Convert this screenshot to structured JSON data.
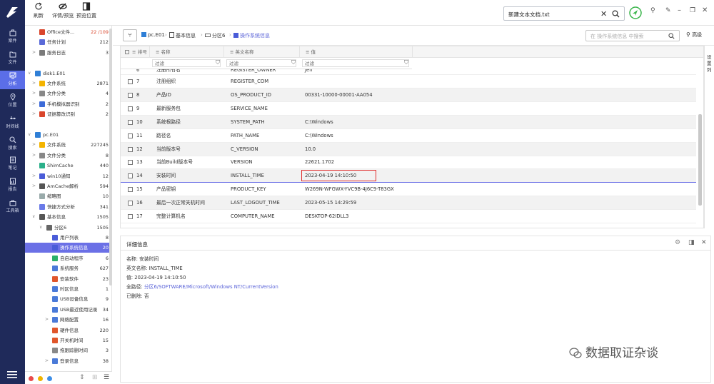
{
  "rail": {
    "items": [
      {
        "label": "案件",
        "icon": "briefcase-icon"
      },
      {
        "label": "文件",
        "icon": "folder-icon"
      },
      {
        "label": "分析",
        "icon": "analysis-icon",
        "active": true
      },
      {
        "label": "位置",
        "icon": "location-icon"
      },
      {
        "label": "时间线",
        "icon": "timeline-icon"
      },
      {
        "label": "搜索",
        "icon": "search-icon"
      },
      {
        "label": "笔记",
        "icon": "note-icon"
      },
      {
        "label": "报告",
        "icon": "report-icon"
      },
      {
        "label": "工具箱",
        "icon": "toolbox-icon"
      }
    ]
  },
  "toolbar": {
    "refresh_label": "刷新",
    "detail_label": "详情/预览",
    "preview_pos_label": "预览位置",
    "search_value": "新建文本文档.txt"
  },
  "tree": {
    "rows": [
      {
        "label": "Office文件...",
        "count": "22 /109",
        "indent": 1,
        "icon_color": "#d9452b",
        "redcount": true
      },
      {
        "label": "任务计划",
        "count": "212",
        "indent": 1,
        "icon_color": "#5a6ad8"
      },
      {
        "label": "服务日志",
        "count": "3",
        "indent": 1,
        "icon_color": "#7a7a7a",
        "arrow": ">"
      },
      {
        "label": "",
        "count": "",
        "indent": 0
      },
      {
        "label": "disk1.E01",
        "count": "",
        "indent": 0,
        "icon_color": "#2f7fd6",
        "arrow": "∨"
      },
      {
        "label": "文件系统",
        "count": "2871",
        "indent": 1,
        "icon_color": "#f4b400",
        "arrow": ">"
      },
      {
        "label": "文件分类",
        "count": "4",
        "indent": 1,
        "icon_color": "#888",
        "arrow": ">"
      },
      {
        "label": "手机模拟器识别",
        "count": "2",
        "indent": 1,
        "icon_color": "#3d6bd8",
        "arrow": ">"
      },
      {
        "label": "证据篡改识别",
        "count": "2",
        "indent": 1,
        "icon_color": "#d9452b",
        "arrow": ">"
      },
      {
        "label": "",
        "count": "",
        "indent": 0
      },
      {
        "label": "pc.E01",
        "count": "",
        "indent": 0,
        "icon_color": "#2f7fd6",
        "arrow": "∨"
      },
      {
        "label": "文件系统",
        "count": "227245",
        "indent": 1,
        "icon_color": "#f4b400",
        "arrow": ">"
      },
      {
        "label": "文件分类",
        "count": "8",
        "indent": 1,
        "icon_color": "#888",
        "arrow": ">"
      },
      {
        "label": "ShimCache",
        "count": "440",
        "indent": 1,
        "icon_color": "#2bb08a"
      },
      {
        "label": "win10通知",
        "count": "12",
        "indent": 1,
        "icon_color": "#4a5cd8",
        "arrow": ">"
      },
      {
        "label": "AmCache解析",
        "count": "594",
        "indent": 1,
        "icon_color": "#555",
        "arrow": ">"
      },
      {
        "label": "缩略图",
        "count": "10",
        "indent": 1,
        "icon_color": "#9aa",
        "arrow": ""
      },
      {
        "label": "快捷方式分析",
        "count": "341",
        "indent": 1,
        "icon_color": "#6a7ae8"
      },
      {
        "label": "基本信息",
        "count": "1505",
        "indent": 1,
        "icon_color": "#555",
        "arrow": "∨"
      },
      {
        "label": "分区6",
        "count": "1505",
        "indent": 2,
        "icon_color": "#666",
        "arrow": "∨"
      },
      {
        "label": "用户列表",
        "count": "8",
        "indent": 3,
        "icon_color": "#4a5cd8"
      },
      {
        "label": "操作系统信息",
        "count": "20",
        "indent": 3,
        "icon_color": "#4a5cd8",
        "selected": true
      },
      {
        "label": "自启动程序",
        "count": "6",
        "indent": 3,
        "icon_color": "#2bb06a"
      },
      {
        "label": "系统服务",
        "count": "627",
        "indent": 3,
        "icon_color": "#4a7ad8"
      },
      {
        "label": "安装软件",
        "count": "23",
        "indent": 3,
        "icon_color": "#e0562b"
      },
      {
        "label": "时区信息",
        "count": "1",
        "indent": 3,
        "icon_color": "#4a7ad8"
      },
      {
        "label": "USB设备信息",
        "count": "9",
        "indent": 3,
        "icon_color": "#4a7ad8"
      },
      {
        "label": "USB最近使用记录",
        "count": "34",
        "indent": 3,
        "icon_color": "#4a7ad8"
      },
      {
        "label": "网络配置",
        "count": "16",
        "indent": 3,
        "icon_color": "#4a7ad8",
        "arrow": ">"
      },
      {
        "label": "硬件信息",
        "count": "220",
        "indent": 3,
        "icon_color": "#e0562b"
      },
      {
        "label": "开关机时间",
        "count": "15",
        "indent": 3,
        "icon_color": "#e0562b"
      },
      {
        "label": "拖跟踪删时间",
        "count": "3",
        "indent": 3,
        "icon_color": "#888"
      },
      {
        "label": "登录信息",
        "count": "38",
        "indent": 3,
        "icon_color": "#4a7ad8",
        "arrow": ">"
      }
    ]
  },
  "breadcrumb": {
    "items": [
      "pc.E01",
      "基本信息",
      "分区6",
      "操作系统信息"
    ],
    "search_placeholder": "在 操作系统信息 中搜索",
    "advanced_label": "高级"
  },
  "grid": {
    "headers": [
      "排号",
      "名称",
      "英文名称",
      "值"
    ],
    "filter_placeholder": "过滤",
    "partial_top": {
      "no": "6",
      "name": "注册所有者",
      "en": "REGISTER_OWNER",
      "val": "Jeff"
    },
    "rows": [
      {
        "no": "7",
        "name": "注册组织",
        "en": "REGISTER_COM",
        "val": ""
      },
      {
        "no": "8",
        "name": "产品ID",
        "en": "OS_PRODUCT_ID",
        "val": "00331-10000-00001-AA054"
      },
      {
        "no": "9",
        "name": "最新服务包",
        "en": "SERVICE_NAME",
        "val": ""
      },
      {
        "no": "10",
        "name": "系统根路径",
        "en": "SYSTEM_PATH",
        "val": "C:\\Windows"
      },
      {
        "no": "11",
        "name": "路径名",
        "en": "PATH_NAME",
        "val": "C:\\Windows"
      },
      {
        "no": "12",
        "name": "当前版本号",
        "en": "C_VERSION",
        "val": "10.0"
      },
      {
        "no": "13",
        "name": "当前Build版本号",
        "en": "VERSION",
        "val": "22621.1702"
      },
      {
        "no": "14",
        "name": "安装时间",
        "en": "INSTALL_TIME",
        "val": "2023-04-19 14:10:50",
        "highlight": true
      },
      {
        "no": "15",
        "name": "产品密钥",
        "en": "PRODUCT_KEY",
        "val": "W269N-WFGWX-YVC9B-4J6C9-T83GX"
      },
      {
        "no": "16",
        "name": "最后一次正常关机时间",
        "en": "LAST_LOGOUT_TIME",
        "val": "2023-05-15 14:29:59"
      },
      {
        "no": "17",
        "name": "完整计算机名",
        "en": "COMPUTER_NAME",
        "val": "DESKTOP-62IDLL3"
      }
    ],
    "side_label": "设置列"
  },
  "details": {
    "title": "详细信息",
    "name_key": "名称:",
    "name_val": "安装时间",
    "en_key": "英文名称:",
    "en_val": "INSTALL_TIME",
    "value_key": "值:",
    "value_val": "2023-04-19 14:10:50",
    "path_key": "全路径:",
    "path_val": "分区6/SOFTWARE/Microsoft/Windows NT/CurrentVersion",
    "deleted_key": "已删除:",
    "deleted_val": "否"
  },
  "watermark": "数据取证杂谈",
  "colors": {
    "rail_bg": "#1f2a5a",
    "accent": "#6b70e6",
    "highlight_border": "#e03030",
    "status_green": "#3ab54a"
  }
}
